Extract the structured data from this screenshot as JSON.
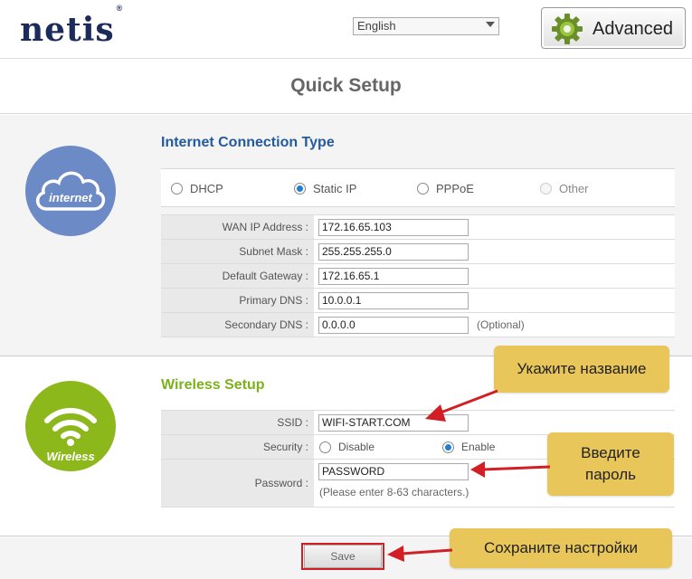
{
  "header": {
    "logo": "netis",
    "logo_mark": "®",
    "language": "English",
    "advanced_label": "Advanced"
  },
  "page_title": "Quick Setup",
  "internet": {
    "icon_label": "internet",
    "section_title": "Internet Connection Type",
    "connection_types": [
      {
        "label": "DHCP",
        "selected": false,
        "enabled": true
      },
      {
        "label": "Static IP",
        "selected": true,
        "enabled": true
      },
      {
        "label": "PPPoE",
        "selected": false,
        "enabled": true
      },
      {
        "label": "Other",
        "selected": false,
        "enabled": false
      }
    ],
    "fields": [
      {
        "label": "WAN IP Address :",
        "value": "172.16.65.103"
      },
      {
        "label": "Subnet Mask :",
        "value": "255.255.255.0"
      },
      {
        "label": "Default Gateway :",
        "value": "172.16.65.1"
      },
      {
        "label": "Primary DNS :",
        "value": "10.0.0.1"
      },
      {
        "label": "Secondary DNS :",
        "value": "0.0.0.0",
        "note": "(Optional)"
      }
    ]
  },
  "wireless": {
    "icon_label": "Wireless",
    "section_title": "Wireless Setup",
    "ssid_label": "SSID :",
    "ssid_value": "WIFI-START.COM",
    "security_label": "Security :",
    "security_options": [
      {
        "label": "Disable",
        "selected": false
      },
      {
        "label": "Enable",
        "selected": true
      }
    ],
    "password_label": "Password :",
    "password_value": "PASSWORD",
    "password_hint": "(Please enter 8-63 characters.)"
  },
  "footer": {
    "save_label": "Save"
  },
  "callouts": {
    "ssid_hint": "Укажите название",
    "password_hint_line1": "Введите",
    "password_hint_line2": "пароль",
    "save_hint": "Сохраните настройки"
  },
  "colors": {
    "internet_circle": "#6b8ac6",
    "wireless_circle": "#8cb81c",
    "internet_title": "#235a9c",
    "wireless_title": "#7bb21c",
    "callout": "#e8c65a",
    "arrow": "#d21f25",
    "radio_selected": "#1e7fd6"
  }
}
